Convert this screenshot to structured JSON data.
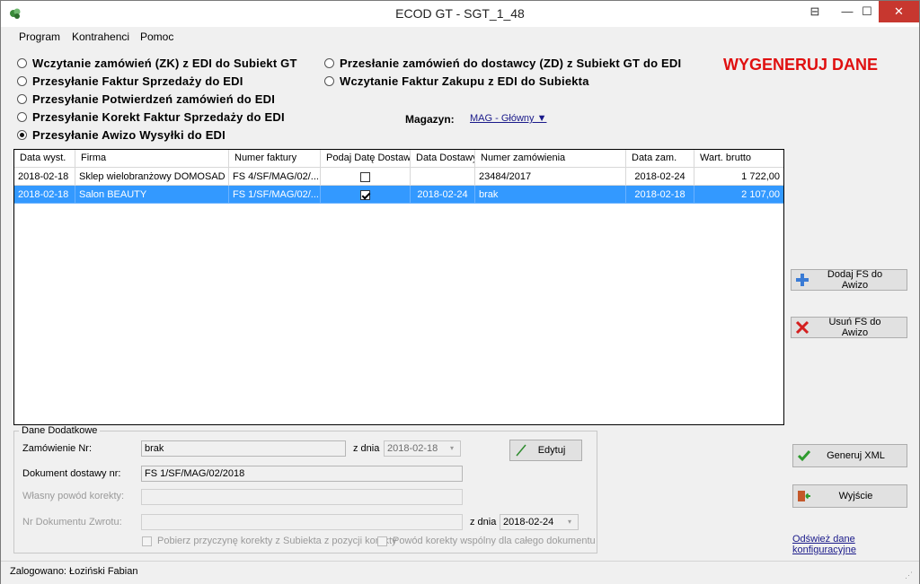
{
  "window": {
    "title": "ECOD GT -  SGT_1_48",
    "restore_glyph": "⊟",
    "minimize_glyph": "—",
    "maximize_glyph": "☐",
    "close_glyph": "✕"
  },
  "menu": {
    "items": [
      "Program",
      "Kontrahenci",
      "Pomoc"
    ]
  },
  "options": {
    "left": [
      {
        "label": "Wczytanie zamówień (ZK) z EDI do Subiekt GT",
        "selected": false
      },
      {
        "label": "Przesyłanie Faktur Sprzedaży do EDI",
        "selected": false
      },
      {
        "label": "Przesyłanie Potwierdzeń zamówień do EDI",
        "selected": false
      },
      {
        "label": "Przesyłanie Korekt Faktur Sprzedaży do EDI",
        "selected": false
      },
      {
        "label": "Przesyłanie Awizo Wysyłki do EDI",
        "selected": true
      }
    ],
    "right": [
      {
        "label": "Przesłanie zamówień do dostawcy (ZD) z Subiekt GT do EDI",
        "selected": false
      },
      {
        "label": "Wczytanie Faktur Zakupu z EDI do Subiekta",
        "selected": false
      }
    ]
  },
  "generate_title": "WYGENERUJ DANE",
  "warehouse": {
    "label": "Magazyn:",
    "value": "MAG - Główny ▼"
  },
  "grid": {
    "columns": [
      "Data wyst.",
      "Firma",
      "Numer faktury",
      "Podaj Datę Dostawy",
      "Data Dostawy",
      "Numer zamówienia",
      "Data zam.",
      "Wart. brutto"
    ],
    "rows": [
      {
        "data_wyst": "2018-02-18",
        "firma": "Sklep wielobranżowy DOMOSAD",
        "numer_faktury": "FS 4/SF/MAG/02/...",
        "podaj_date": false,
        "data_dostawy": "",
        "numer_zamowienia": "23484/2017",
        "data_zam": "2018-02-24",
        "wart_brutto": "1 722,00",
        "selected": false
      },
      {
        "data_wyst": "2018-02-18",
        "firma": "Salon BEAUTY",
        "numer_faktury": "FS 1/SF/MAG/02/...",
        "podaj_date": true,
        "data_dostawy": "2018-02-24",
        "numer_zamowienia": "brak",
        "data_zam": "2018-02-18",
        "wart_brutto": "2 107,00",
        "selected": true
      }
    ]
  },
  "side_buttons": {
    "add_fs": "Dodaj FS do Awizo",
    "remove_fs": "Usuń FS do Awizo",
    "generate_xml": "Generuj XML",
    "exit": "Wyjście"
  },
  "details": {
    "group_title": "Dane Dodatkowe",
    "order_no_label": "Zamówienie Nr:",
    "order_no_value": "brak",
    "date_label": "z dnia",
    "order_date_value": "2018-02-18",
    "edit_button": "Edytuj",
    "delivery_doc_label": "Dokument dostawy nr:",
    "delivery_doc_value": "FS 1/SF/MAG/02/2018",
    "correction_reason_label": "Własny powód korekty:",
    "correction_reason_value": "",
    "return_doc_label": "Nr Dokumentu Zwrotu:",
    "return_doc_value": "",
    "return_date_label": "z dnia",
    "return_date_value": "2018-02-24",
    "chk_reason_from_subiekt": "Pobierz przyczynę korekty z Subiekta z pozycji korekty",
    "chk_common_reason": "Powód korekty wspólny dla całego dokumentu"
  },
  "refresh_link": "Odśwież dane konfiguracyjne",
  "status": {
    "logged_in": "Zalogowano: Łoziński Fabian"
  },
  "colors": {
    "accent_red": "#e01010",
    "selection_blue": "#3399ff",
    "close_red": "#c7372f"
  }
}
